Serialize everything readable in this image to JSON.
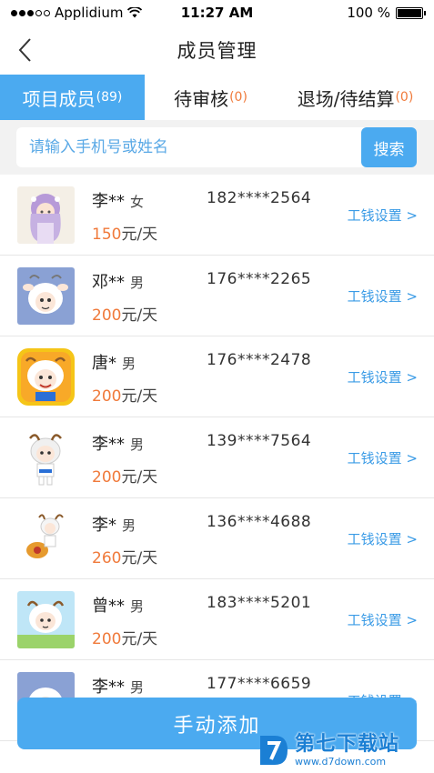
{
  "status_bar": {
    "carrier": "Applidium",
    "time": "11:27 AM",
    "battery": "100 %"
  },
  "nav": {
    "title": "成员管理"
  },
  "tabs": [
    {
      "label": "项目成员",
      "count": "(89)",
      "active": true
    },
    {
      "label": "待审核",
      "count": "(0)",
      "active": false
    },
    {
      "label": "退场/待结算",
      "count": "(0)",
      "active": false
    }
  ],
  "search": {
    "placeholder": "请输入手机号或姓名",
    "button_label": "搜索"
  },
  "members": [
    {
      "name": "李**",
      "gender": "女",
      "wage": "150",
      "unit": "元/天",
      "phone": "182****2564",
      "setting_label": "工钱设置 >",
      "avatar": "girl-avatar"
    },
    {
      "name": "邓**",
      "gender": "男",
      "wage": "200",
      "unit": "元/天",
      "phone": "176****2265",
      "setting_label": "工钱设置 >",
      "avatar": "sheep-avatar"
    },
    {
      "name": "唐*",
      "gender": "男",
      "wage": "200",
      "unit": "元/天",
      "phone": "176****2478",
      "setting_label": "工钱设置 >",
      "avatar": "sheep-avatar"
    },
    {
      "name": "李**",
      "gender": "男",
      "wage": "200",
      "unit": "元/天",
      "phone": "139****7564",
      "setting_label": "工钱设置 >",
      "avatar": "sheep-avatar"
    },
    {
      "name": "李*",
      "gender": "男",
      "wage": "260",
      "unit": "元/天",
      "phone": "136****4688",
      "setting_label": "工钱设置 >",
      "avatar": "sheep-avatar"
    },
    {
      "name": "曾**",
      "gender": "男",
      "wage": "200",
      "unit": "元/天",
      "phone": "183****5201",
      "setting_label": "工钱设置 >",
      "avatar": "sheep-avatar"
    },
    {
      "name": "李**",
      "gender": "男",
      "wage": "",
      "unit": "",
      "phone": "177****6659",
      "setting_label": "工钱设置 >",
      "avatar": "sheep-avatar"
    }
  ],
  "add_button": {
    "label": "手动添加"
  },
  "watermark": {
    "main": "第七下载站",
    "sub": "www.d7down.com"
  },
  "colors": {
    "accent": "#4baaf0",
    "wage": "#f07a3b",
    "link": "#3a9be6"
  }
}
